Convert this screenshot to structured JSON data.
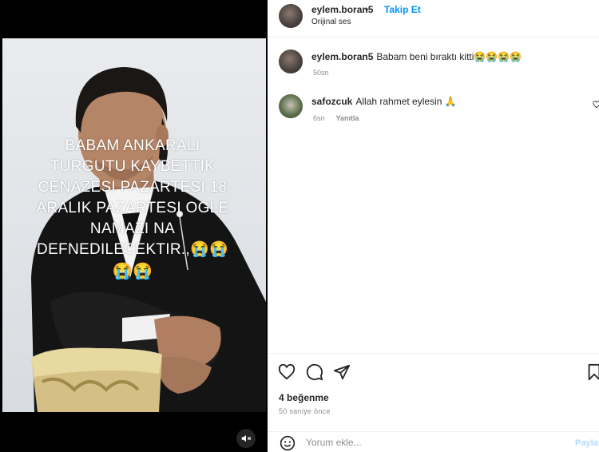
{
  "post": {
    "overlay_lines": [
      "BABAM ANKARALI",
      "TURGUTU KAYBETTIK",
      "CENAZESI PAZARTESI 18",
      "ARALIK PAZARTESI OGLE",
      "NAMAZI NA",
      "DEFNEDILECEKTIR.,😭😭"
    ],
    "overlay_emoji": "😭😭"
  },
  "header": {
    "username": "eylem.boran5",
    "separator": "•",
    "follow_label": "Takip Et",
    "audio_label": "Orijinal ses"
  },
  "comments": [
    {
      "username": "eylem.boran5",
      "text": "Babam beni bıraktı kitti😭😭😭😭",
      "time": "50sn",
      "reply": ""
    },
    {
      "username": "safozcuk",
      "text": "Allah rahmet eylesin 🙏",
      "time": "6sn",
      "reply": "Yanıtla"
    }
  ],
  "actions": {
    "likes": "4 beğenme",
    "timestamp": "50 saniye önce",
    "icons": [
      "heart-icon",
      "comment-icon",
      "share-icon",
      "bookmark-icon",
      "emoji-icon",
      "mute-icon"
    ]
  },
  "comment_box": {
    "placeholder": "Yorum ekle...",
    "post_label": "Paylaş"
  },
  "colors": {
    "accent": "#0095f6",
    "text": "#262626",
    "muted": "#8e8e8e",
    "post_disabled": "#b3dbff"
  }
}
